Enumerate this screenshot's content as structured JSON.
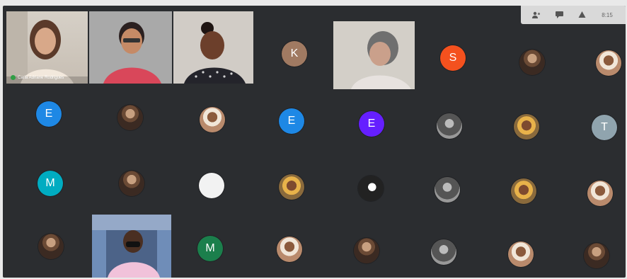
{
  "toolbar": {
    "icons": [
      "people-icon",
      "chat-icon",
      "activities-icon",
      "clock-icon"
    ],
    "time_label": "8:15"
  },
  "video_tiles": [
    {
      "id": "tile1",
      "participant_name": "Carla Adriane Rodrigues",
      "mic": "on"
    },
    {
      "id": "tile2"
    },
    {
      "id": "tile3"
    },
    {
      "id": "tile4"
    },
    {
      "id": "tile5"
    }
  ],
  "avatars": [
    {
      "letter": "K",
      "color": "#a07a62"
    },
    {
      "letter": "S",
      "color": "#f4511e"
    },
    {
      "letter": "E",
      "color": "#1e88e5"
    },
    {
      "letter": "E",
      "color": "#1e88e5"
    },
    {
      "letter": "E",
      "color": "#651fff"
    },
    {
      "letter": "T",
      "color": "#90a4ae"
    },
    {
      "letter": "M",
      "color": "#00acc1"
    },
    {
      "letter": "M",
      "color": "#1b7f4c"
    }
  ]
}
